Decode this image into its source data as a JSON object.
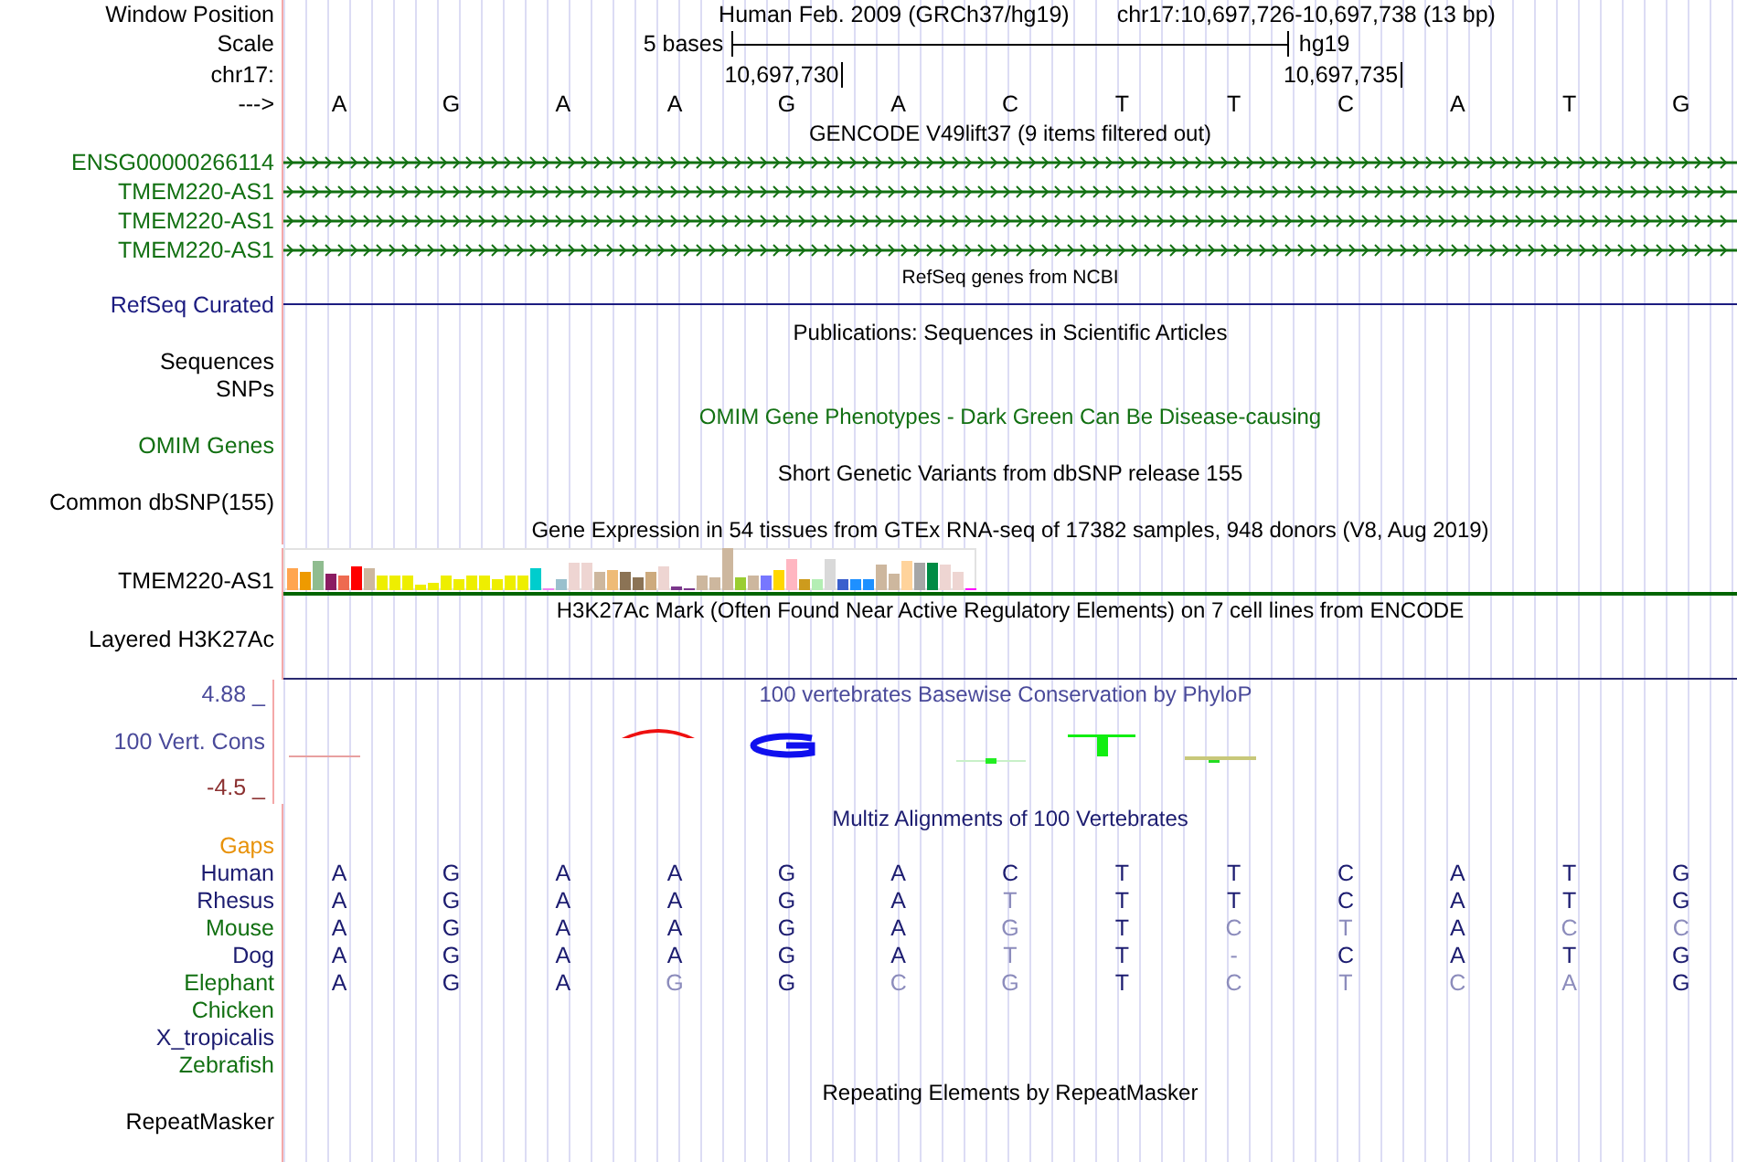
{
  "header": {
    "assembly": "Human Feb. 2009 (GRCh37/hg19)",
    "position": "chr17:10,697,726-10,697,738 (13 bp)"
  },
  "labels": {
    "window_position": "Window Position",
    "scale": "Scale",
    "chromosome": "chr17:",
    "strand": "--->"
  },
  "scale": {
    "label": "5 bases",
    "assembly": "hg19"
  },
  "bases": [
    {
      "base": "A"
    },
    {
      "base": "G"
    },
    {
      "base": "A"
    },
    {
      "base": "A"
    },
    {
      "base": "G",
      "coordinate": "10,697,730"
    },
    {
      "base": "A"
    },
    {
      "base": "C"
    },
    {
      "base": "T"
    },
    {
      "base": "T"
    },
    {
      "base": "C",
      "coordinate": "10,697,735"
    },
    {
      "base": "A"
    },
    {
      "base": "T"
    },
    {
      "base": "G"
    }
  ],
  "tracks": [
    {
      "kind": "genes",
      "title": "GENCODE V49lift37 (9 items filtered out)",
      "color": "#127012",
      "items": [
        {
          "name": "ENSG00000266114"
        },
        {
          "name": "TMEM220-AS1"
        },
        {
          "name": "TMEM220-AS1"
        },
        {
          "name": "TMEM220-AS1"
        }
      ]
    },
    {
      "kind": "line",
      "title": "RefSeq genes from NCBI",
      "color": "#1c1c80",
      "labels": [
        "RefSeq Curated"
      ]
    },
    {
      "kind": "empty",
      "title": "Publications: Sequences in Scientific Articles",
      "color": "#000000",
      "labels": [
        "Sequences",
        "SNPs"
      ]
    },
    {
      "kind": "empty",
      "title": "OMIM Gene Phenotypes - Dark Green Can Be Disease-causing",
      "color": "#127012",
      "labels": [
        "OMIM Genes"
      ]
    },
    {
      "kind": "empty",
      "title": "Short Genetic Variants from dbSNP release 155",
      "color": "#000000",
      "labels": [
        "Common dbSNP(155)"
      ]
    },
    {
      "kind": "expression",
      "title": "Gene Expression in 54 tissues from GTEx RNA-seq of 17382 samples, 948 donors (V8, Aug 2019)",
      "color": "#000000",
      "labels": [
        "TMEM220-AS1"
      ]
    },
    {
      "kind": "signal",
      "title": "H3K27Ac Mark (Often Found Near Active Regulatory Elements) on 7 cell lines from ENCODE",
      "color": "#000000",
      "labels": [
        "Layered H3K27Ac"
      ]
    },
    {
      "kind": "conservation",
      "title": "100 vertebrates Basewise Conservation by PhyloP",
      "color": "#4a4a9a",
      "labels": [
        "100 Vert. Cons"
      ],
      "ymax": "4.88 _",
      "ymin": "-4.5 _"
    },
    {
      "kind": "alignment",
      "title": "Multiz Alignments of 100 Vertebrates",
      "color": "#1c1c70",
      "gaps": {
        "label": "Gaps",
        "color": "#e8920a"
      },
      "species": [
        {
          "name": "Human",
          "color": "#1c1c70",
          "bases": [
            {
              "base": "A",
              "match": true
            },
            {
              "base": "G",
              "match": true
            },
            {
              "base": "A",
              "match": true
            },
            {
              "base": "A",
              "match": true
            },
            {
              "base": "G",
              "match": true
            },
            {
              "base": "A",
              "match": true
            },
            {
              "base": "C",
              "match": true
            },
            {
              "base": "T",
              "match": true
            },
            {
              "base": "T",
              "match": true
            },
            {
              "base": "C",
              "match": true
            },
            {
              "base": "A",
              "match": true
            },
            {
              "base": "T",
              "match": true
            },
            {
              "base": "G",
              "match": true
            }
          ]
        },
        {
          "name": "Rhesus",
          "color": "#1c1c70",
          "bases": [
            {
              "base": "A",
              "match": true
            },
            {
              "base": "G",
              "match": true
            },
            {
              "base": "A",
              "match": true
            },
            {
              "base": "A",
              "match": true
            },
            {
              "base": "G",
              "match": true
            },
            {
              "base": "A",
              "match": true
            },
            {
              "base": "T",
              "match": false
            },
            {
              "base": "T",
              "match": true
            },
            {
              "base": "T",
              "match": true
            },
            {
              "base": "C",
              "match": true
            },
            {
              "base": "A",
              "match": true
            },
            {
              "base": "T",
              "match": true
            },
            {
              "base": "G",
              "match": true
            }
          ]
        },
        {
          "name": "Mouse",
          "color": "#127012",
          "bases": [
            {
              "base": "A",
              "match": true
            },
            {
              "base": "G",
              "match": true
            },
            {
              "base": "A",
              "match": true
            },
            {
              "base": "A",
              "match": true
            },
            {
              "base": "G",
              "match": true
            },
            {
              "base": "A",
              "match": true
            },
            {
              "base": "G",
              "match": false
            },
            {
              "base": "T",
              "match": true
            },
            {
              "base": "C",
              "match": false
            },
            {
              "base": "T",
              "match": false
            },
            {
              "base": "A",
              "match": true
            },
            {
              "base": "C",
              "match": false
            },
            {
              "base": "C",
              "match": false
            }
          ]
        },
        {
          "name": "Dog",
          "color": "#1c1c70",
          "bases": [
            {
              "base": "A",
              "match": true
            },
            {
              "base": "G",
              "match": true
            },
            {
              "base": "A",
              "match": true
            },
            {
              "base": "A",
              "match": true
            },
            {
              "base": "G",
              "match": true
            },
            {
              "base": "A",
              "match": true
            },
            {
              "base": "T",
              "match": false
            },
            {
              "base": "T",
              "match": true
            },
            {
              "base": "-",
              "match": false
            },
            {
              "base": "C",
              "match": true
            },
            {
              "base": "A",
              "match": true
            },
            {
              "base": "T",
              "match": true
            },
            {
              "base": "G",
              "match": true
            }
          ]
        },
        {
          "name": "Elephant",
          "color": "#127012",
          "bases": [
            {
              "base": "A",
              "match": true
            },
            {
              "base": "G",
              "match": true
            },
            {
              "base": "A",
              "match": true
            },
            {
              "base": "G",
              "match": false
            },
            {
              "base": "G",
              "match": true
            },
            {
              "base": "C",
              "match": false
            },
            {
              "base": "G",
              "match": false
            },
            {
              "base": "T",
              "match": true
            },
            {
              "base": "C",
              "match": false
            },
            {
              "base": "T",
              "match": false
            },
            {
              "base": "C",
              "match": false
            },
            {
              "base": "A",
              "match": false
            },
            {
              "base": "G",
              "match": true
            }
          ]
        },
        {
          "name": "Chicken",
          "color": "#127012"
        },
        {
          "name": "X_tropicalis",
          "color": "#1c1c70"
        },
        {
          "name": "Zebrafish",
          "color": "#127012"
        }
      ]
    },
    {
      "kind": "empty",
      "title": "Repeating Elements by RepeatMasker",
      "color": "#000000",
      "labels": [
        "RepeatMasker"
      ]
    }
  ]
}
